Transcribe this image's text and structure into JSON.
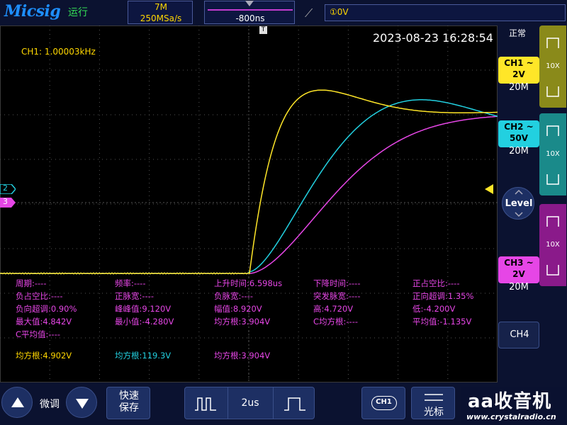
{
  "header": {
    "brand": "Micsig",
    "run_state": "运行",
    "memory_depth": "7M",
    "sample_rate": "250MSa/s",
    "time_offset": "-800ns",
    "trigger_level": "①0V"
  },
  "screen": {
    "datetime": "2023-08-23 16:28:54",
    "ch1_frequency": "CH1: 1.00003kHz",
    "mode": "正常",
    "channel_markers": {
      "ch2": "2",
      "ch3": "3"
    }
  },
  "measurements": {
    "rows": [
      [
        "周期:----",
        "频率:----",
        "上升时间:6.598us",
        "下降时间:----",
        "正占空比:----"
      ],
      [
        "负占空比:----",
        "正脉宽:----",
        "负脉宽:----",
        "突发脉宽:----",
        "正向超调:1.35%"
      ],
      [
        "负向超调:0.90%",
        "峰峰值:9.120V",
        "幅值:8.920V",
        "高:4.720V",
        "低:-4.200V"
      ],
      [
        "最大值:4.842V",
        "最小值:-4.280V",
        "均方根:3.904V",
        "C均方根:----",
        "平均值:-1.135V"
      ],
      [
        "C平均值:----"
      ]
    ],
    "rms_row": {
      "ch1": "均方根:4.902V",
      "ch2": "均方根:119.3V",
      "ch3": "均方根:3.904V"
    }
  },
  "channels": {
    "ch1": {
      "name": "CH1 ~",
      "scale": "2V",
      "bw": "20M",
      "probe": "10X",
      "color": "#ffe628"
    },
    "ch2": {
      "name": "CH2 ~",
      "scale": "50V",
      "bw": "20M",
      "probe": "10X",
      "color": "#22d0e0"
    },
    "ch3": {
      "name": "CH3 ~",
      "scale": "2V",
      "bw": "20M",
      "probe": "10X",
      "color": "#e646e6"
    },
    "ch4": {
      "name": "CH4"
    }
  },
  "level": {
    "label": "Level"
  },
  "bottom": {
    "fine_label": "微调",
    "quick_save": "快速\n保存",
    "timebase": "2us",
    "ch1_icon": "CH1",
    "cursor_label": "光标",
    "watermark": "aa收音机",
    "watermark_url": "www.crystalradio.cn"
  },
  "chart_data": {
    "type": "line",
    "series": [
      {
        "name": "CH1",
        "color": "#ffe628"
      },
      {
        "name": "CH2",
        "color": "#22d0e0"
      },
      {
        "name": "CH3",
        "color": "#e646e6"
      }
    ]
  }
}
